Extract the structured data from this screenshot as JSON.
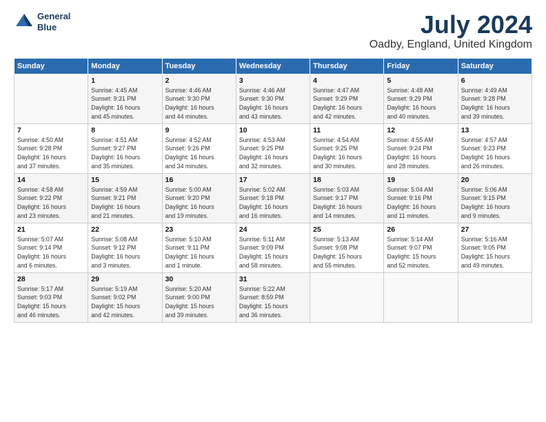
{
  "logo": {
    "line1": "General",
    "line2": "Blue"
  },
  "header": {
    "title": "July 2024",
    "subtitle": "Oadby, England, United Kingdom"
  },
  "days_header": [
    "Sunday",
    "Monday",
    "Tuesday",
    "Wednesday",
    "Thursday",
    "Friday",
    "Saturday"
  ],
  "weeks": [
    [
      {
        "day": "",
        "info": ""
      },
      {
        "day": "1",
        "info": "Sunrise: 4:45 AM\nSunset: 9:31 PM\nDaylight: 16 hours\nand 45 minutes."
      },
      {
        "day": "2",
        "info": "Sunrise: 4:46 AM\nSunset: 9:30 PM\nDaylight: 16 hours\nand 44 minutes."
      },
      {
        "day": "3",
        "info": "Sunrise: 4:46 AM\nSunset: 9:30 PM\nDaylight: 16 hours\nand 43 minutes."
      },
      {
        "day": "4",
        "info": "Sunrise: 4:47 AM\nSunset: 9:29 PM\nDaylight: 16 hours\nand 42 minutes."
      },
      {
        "day": "5",
        "info": "Sunrise: 4:48 AM\nSunset: 9:29 PM\nDaylight: 16 hours\nand 40 minutes."
      },
      {
        "day": "6",
        "info": "Sunrise: 4:49 AM\nSunset: 9:28 PM\nDaylight: 16 hours\nand 39 minutes."
      }
    ],
    [
      {
        "day": "7",
        "info": "Sunrise: 4:50 AM\nSunset: 9:28 PM\nDaylight: 16 hours\nand 37 minutes."
      },
      {
        "day": "8",
        "info": "Sunrise: 4:51 AM\nSunset: 9:27 PM\nDaylight: 16 hours\nand 35 minutes."
      },
      {
        "day": "9",
        "info": "Sunrise: 4:52 AM\nSunset: 9:26 PM\nDaylight: 16 hours\nand 34 minutes."
      },
      {
        "day": "10",
        "info": "Sunrise: 4:53 AM\nSunset: 9:25 PM\nDaylight: 16 hours\nand 32 minutes."
      },
      {
        "day": "11",
        "info": "Sunrise: 4:54 AM\nSunset: 9:25 PM\nDaylight: 16 hours\nand 30 minutes."
      },
      {
        "day": "12",
        "info": "Sunrise: 4:55 AM\nSunset: 9:24 PM\nDaylight: 16 hours\nand 28 minutes."
      },
      {
        "day": "13",
        "info": "Sunrise: 4:57 AM\nSunset: 9:23 PM\nDaylight: 16 hours\nand 26 minutes."
      }
    ],
    [
      {
        "day": "14",
        "info": "Sunrise: 4:58 AM\nSunset: 9:22 PM\nDaylight: 16 hours\nand 23 minutes."
      },
      {
        "day": "15",
        "info": "Sunrise: 4:59 AM\nSunset: 9:21 PM\nDaylight: 16 hours\nand 21 minutes."
      },
      {
        "day": "16",
        "info": "Sunrise: 5:00 AM\nSunset: 9:20 PM\nDaylight: 16 hours\nand 19 minutes."
      },
      {
        "day": "17",
        "info": "Sunrise: 5:02 AM\nSunset: 9:18 PM\nDaylight: 16 hours\nand 16 minutes."
      },
      {
        "day": "18",
        "info": "Sunrise: 5:03 AM\nSunset: 9:17 PM\nDaylight: 16 hours\nand 14 minutes."
      },
      {
        "day": "19",
        "info": "Sunrise: 5:04 AM\nSunset: 9:16 PM\nDaylight: 16 hours\nand 11 minutes."
      },
      {
        "day": "20",
        "info": "Sunrise: 5:06 AM\nSunset: 9:15 PM\nDaylight: 16 hours\nand 9 minutes."
      }
    ],
    [
      {
        "day": "21",
        "info": "Sunrise: 5:07 AM\nSunset: 9:14 PM\nDaylight: 16 hours\nand 6 minutes."
      },
      {
        "day": "22",
        "info": "Sunrise: 5:08 AM\nSunset: 9:12 PM\nDaylight: 16 hours\nand 3 minutes."
      },
      {
        "day": "23",
        "info": "Sunrise: 5:10 AM\nSunset: 9:11 PM\nDaylight: 16 hours\nand 1 minute."
      },
      {
        "day": "24",
        "info": "Sunrise: 5:11 AM\nSunset: 9:09 PM\nDaylight: 15 hours\nand 58 minutes."
      },
      {
        "day": "25",
        "info": "Sunrise: 5:13 AM\nSunset: 9:08 PM\nDaylight: 15 hours\nand 55 minutes."
      },
      {
        "day": "26",
        "info": "Sunrise: 5:14 AM\nSunset: 9:07 PM\nDaylight: 15 hours\nand 52 minutes."
      },
      {
        "day": "27",
        "info": "Sunrise: 5:16 AM\nSunset: 9:05 PM\nDaylight: 15 hours\nand 49 minutes."
      }
    ],
    [
      {
        "day": "28",
        "info": "Sunrise: 5:17 AM\nSunset: 9:03 PM\nDaylight: 15 hours\nand 46 minutes."
      },
      {
        "day": "29",
        "info": "Sunrise: 5:19 AM\nSunset: 9:02 PM\nDaylight: 15 hours\nand 42 minutes."
      },
      {
        "day": "30",
        "info": "Sunrise: 5:20 AM\nSunset: 9:00 PM\nDaylight: 15 hours\nand 39 minutes."
      },
      {
        "day": "31",
        "info": "Sunrise: 5:22 AM\nSunset: 8:59 PM\nDaylight: 15 hours\nand 36 minutes."
      },
      {
        "day": "",
        "info": ""
      },
      {
        "day": "",
        "info": ""
      },
      {
        "day": "",
        "info": ""
      }
    ]
  ]
}
